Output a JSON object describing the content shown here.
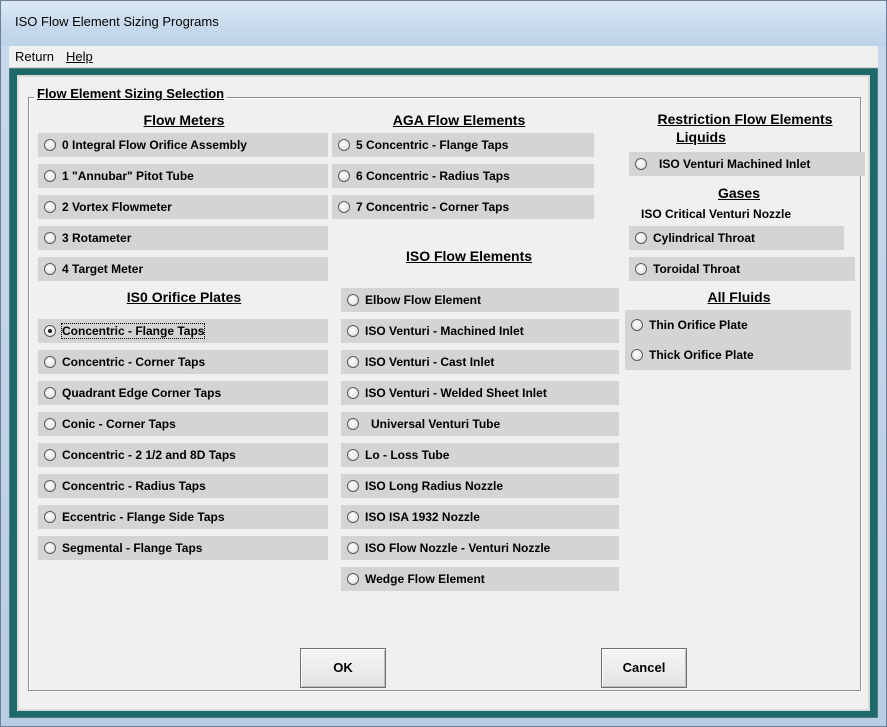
{
  "window": {
    "title": "ISO Flow Element Sizing Programs"
  },
  "menu": {
    "items": [
      "Return",
      "Help"
    ]
  },
  "group": {
    "title": "Flow Element Sizing Selection"
  },
  "columns": {
    "flow_meters": {
      "heading": "Flow Meters",
      "options": [
        {
          "label": "0 Integral Flow Orifice Assembly"
        },
        {
          "label": "1 \"Annubar\" Pitot Tube"
        },
        {
          "label": "2 Vortex Flowmeter"
        },
        {
          "label": "3 Rotameter"
        },
        {
          "label": "4 Target Meter"
        }
      ]
    },
    "iso_orifice": {
      "heading": "IS0 Orifice Plates",
      "options": [
        {
          "label": "Concentric - Flange Taps",
          "selected": true
        },
        {
          "label": "Concentric - Corner Taps"
        },
        {
          "label": "Quadrant Edge Corner Taps"
        },
        {
          "label": "Conic - Corner Taps"
        },
        {
          "label": "Concentric - 2 1/2 and 8D Taps"
        },
        {
          "label": "Concentric - Radius Taps"
        },
        {
          "label": "Eccentric - Flange Side Taps"
        },
        {
          "label": "Segmental - Flange Taps"
        }
      ]
    },
    "aga": {
      "heading": "AGA Flow Elements",
      "options": [
        {
          "label": "5 Concentric - Flange Taps"
        },
        {
          "label": "6 Concentric - Radius Taps"
        },
        {
          "label": "7 Concentric - Corner Taps"
        }
      ]
    },
    "iso_flow": {
      "heading": "ISO Flow Elements",
      "options": [
        {
          "label": "Elbow Flow Element"
        },
        {
          "label": "ISO Venturi - Machined Inlet"
        },
        {
          "label": "ISO Venturi - Cast Inlet"
        },
        {
          "label": "ISO Venturi - Welded Sheet Inlet"
        },
        {
          "label": "Universal Venturi Tube"
        },
        {
          "label": "Lo - Loss Tube"
        },
        {
          "label": "ISO Long Radius Nozzle"
        },
        {
          "label": "ISO ISA 1932 Nozzle"
        },
        {
          "label": "ISO Flow Nozzle - Venturi Nozzle"
        },
        {
          "label": "Wedge Flow Element"
        }
      ]
    },
    "restriction": {
      "heading": "Restriction Flow Elements",
      "liquids_heading": "Liquids",
      "liquids_options": [
        {
          "label": "ISO Venturi Machined Inlet"
        }
      ],
      "gases_heading": "Gases",
      "gases_subheading": "ISO Critical Venturi Nozzle",
      "gases_options": [
        {
          "label": "Cylindrical Throat"
        },
        {
          "label": "Toroidal Throat"
        }
      ],
      "all_heading": "All Fluids",
      "all_options": [
        {
          "label": "Thin Orifice Plate"
        },
        {
          "label": "Thick Orifice Plate"
        }
      ]
    }
  },
  "buttons": {
    "ok": "OK",
    "cancel": "Cancel"
  }
}
